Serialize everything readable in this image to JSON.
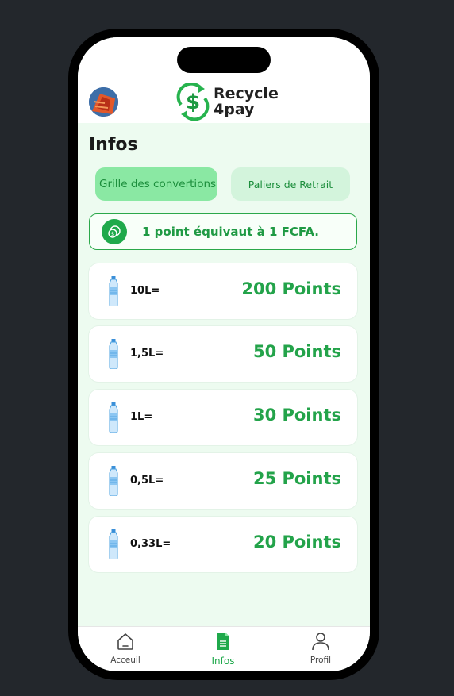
{
  "header": {
    "logo_line1": "Recycle",
    "logo_line2": "4pay"
  },
  "page": {
    "title": "Infos"
  },
  "tabs": [
    {
      "label": "Grille des convertions",
      "active": true
    },
    {
      "label": "Paliers de Retrait",
      "active": false
    }
  ],
  "info": {
    "text": "1 point équivaut à 1 FCFA."
  },
  "conversions": [
    {
      "volume": "10L=",
      "points": "200 Points"
    },
    {
      "volume": "1,5L=",
      "points": "50 Points"
    },
    {
      "volume": "1L=",
      "points": "30 Points"
    },
    {
      "volume": "0,5L=",
      "points": "25 Points"
    },
    {
      "volume": "0,33L=",
      "points": "20 Points"
    }
  ],
  "nav": [
    {
      "label": "Acceuil",
      "icon": "home-icon",
      "active": false
    },
    {
      "label": "Infos",
      "icon": "document-icon",
      "active": true
    },
    {
      "label": "Profil",
      "icon": "user-icon",
      "active": false
    }
  ],
  "colors": {
    "accent": "#1fa94b",
    "screen_bg": "#edfbf0",
    "tab_active": "#8ae8a3",
    "tab_inactive": "#d3f4dc"
  }
}
